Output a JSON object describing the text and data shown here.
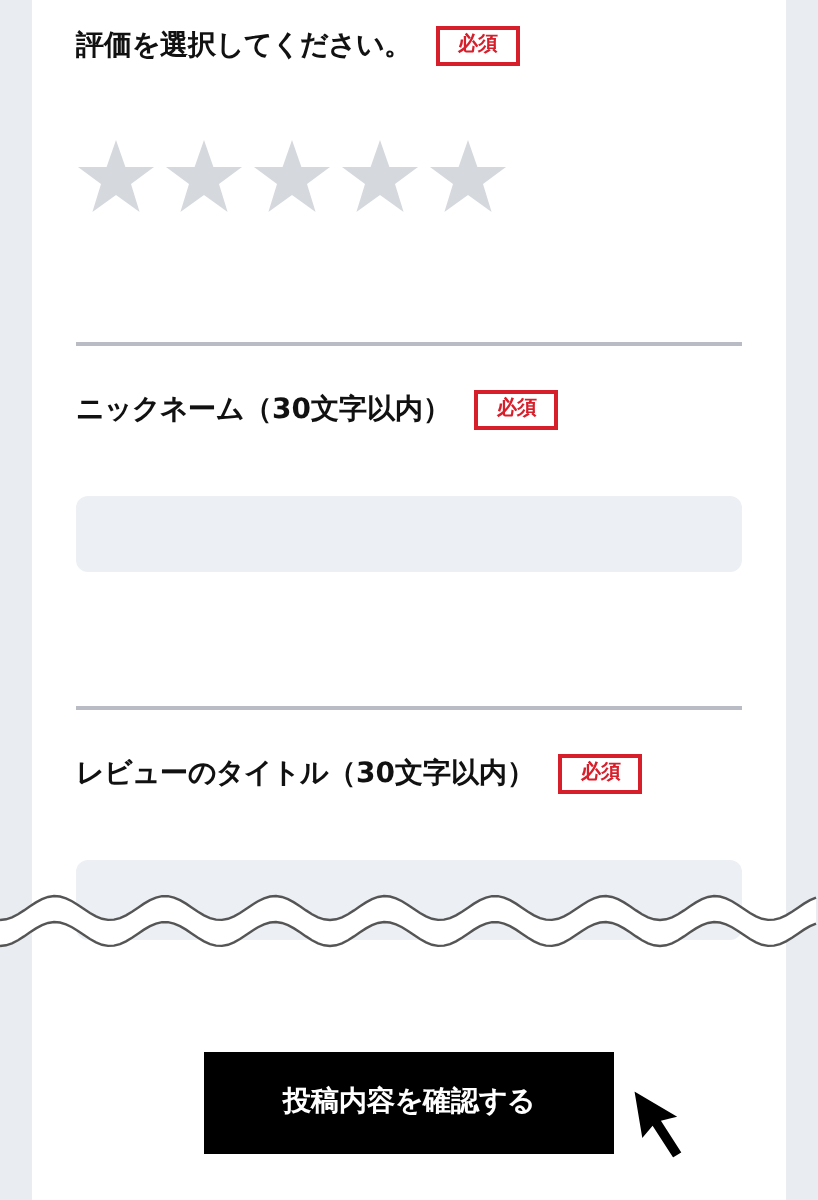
{
  "sections": [
    {
      "kind": "rating",
      "label": "評価を選択してください。",
      "required": "必須",
      "stars": 0
    },
    {
      "kind": "text",
      "label": "ニックネーム（30文字以内）",
      "required": "必須"
    },
    {
      "kind": "text",
      "label": "レビューのタイトル（30文字以内）",
      "required": "必須"
    }
  ],
  "submit_button": "投稿内容を確認する"
}
